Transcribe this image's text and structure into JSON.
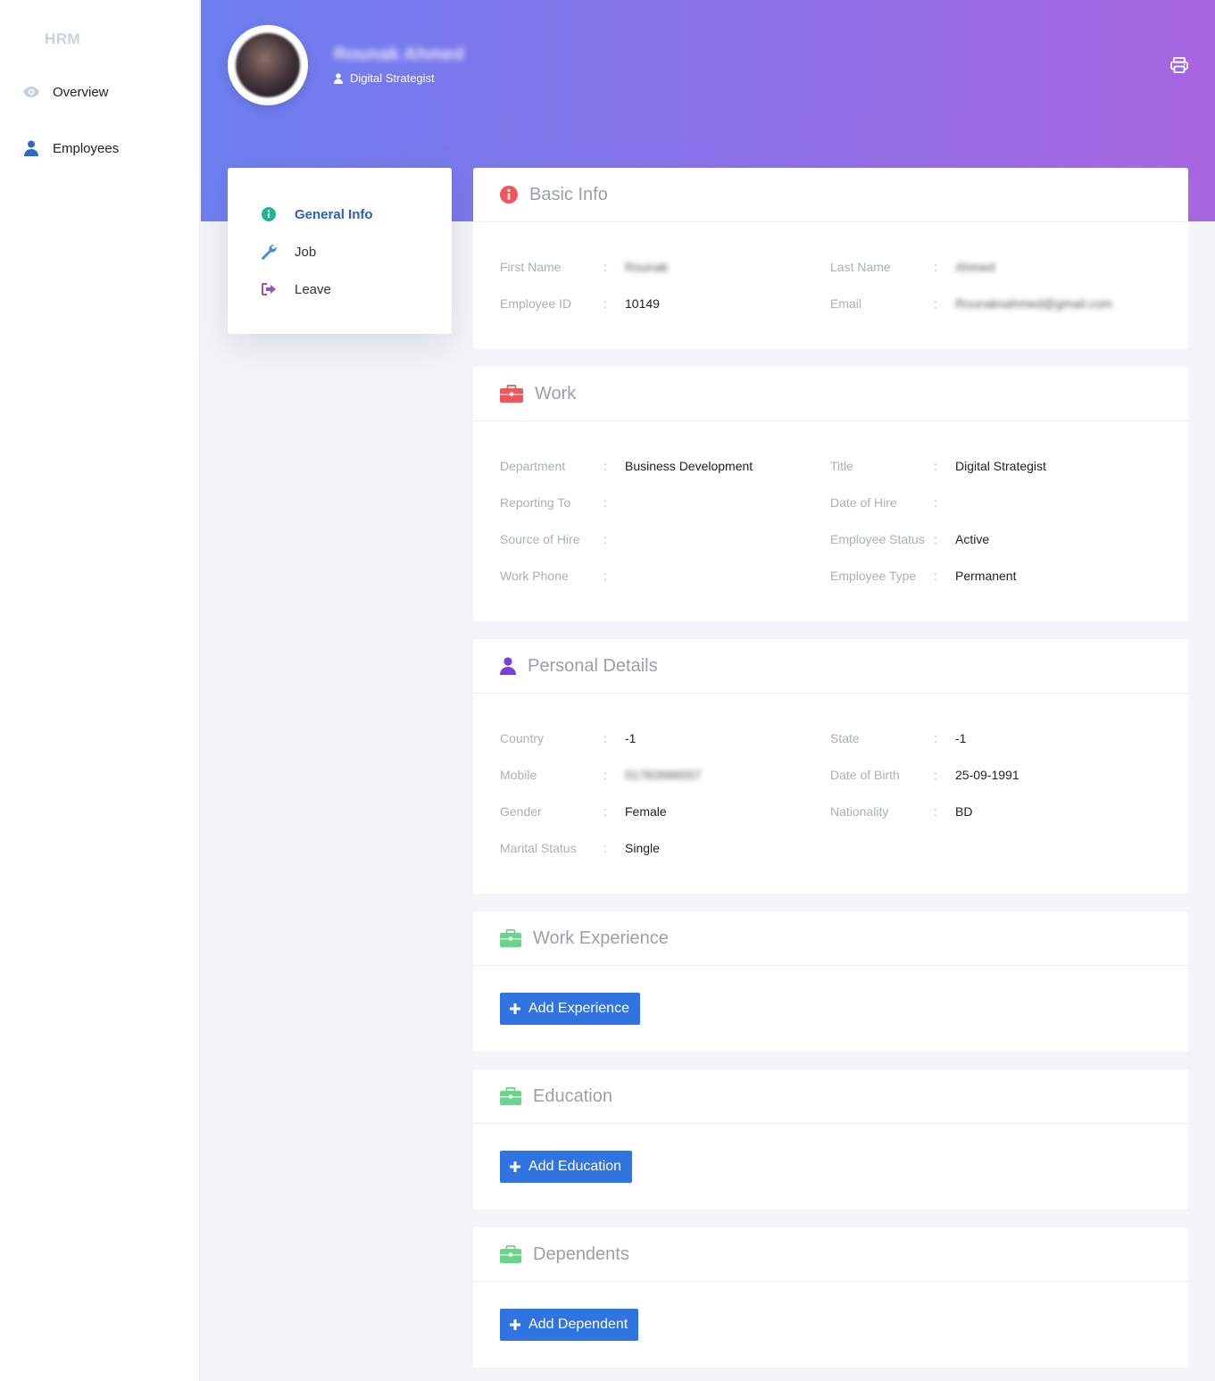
{
  "sidebar": {
    "brand": "HRM",
    "items": [
      {
        "label": "Overview",
        "icon": "eye-icon"
      },
      {
        "label": "Employees",
        "icon": "user-icon"
      }
    ]
  },
  "header": {
    "name": "Rounak Ahmed",
    "role": "Digital Strategist",
    "colors": {
      "start": "#6c7ff0",
      "end": "#a765e0"
    }
  },
  "tabs": [
    {
      "label": "General Info",
      "icon": "info-circle-icon",
      "active": true
    },
    {
      "label": "Job",
      "icon": "wrench-icon",
      "active": false
    },
    {
      "label": "Leave",
      "icon": "sign-out-icon",
      "active": false
    }
  ],
  "basic_info": {
    "title": "Basic Info",
    "fields": {
      "first_name": {
        "label": "First Name",
        "value": "Rounak"
      },
      "last_name": {
        "label": "Last Name",
        "value": "Ahmed"
      },
      "employee_id": {
        "label": "Employee ID",
        "value": "10149"
      },
      "email": {
        "label": "Email",
        "value": "Rounaksahmed@gmail.com"
      }
    }
  },
  "work": {
    "title": "Work",
    "fields": {
      "department": {
        "label": "Department",
        "value": "Business Development"
      },
      "title": {
        "label": "Title",
        "value": "Digital Strategist"
      },
      "reporting_to": {
        "label": "Reporting To",
        "value": ""
      },
      "date_of_hire": {
        "label": "Date of Hire",
        "value": ""
      },
      "source_of_hire": {
        "label": "Source of Hire",
        "value": ""
      },
      "employee_status": {
        "label": "Employee Status",
        "value": "Active"
      },
      "work_phone": {
        "label": "Work Phone",
        "value": ""
      },
      "employee_type": {
        "label": "Employee Type",
        "value": "Permanent"
      }
    }
  },
  "personal": {
    "title": "Personal Details",
    "fields": {
      "country": {
        "label": "Country",
        "value": "-1"
      },
      "state": {
        "label": "State",
        "value": "-1"
      },
      "mobile": {
        "label": "Mobile",
        "value": "01782666557"
      },
      "dob": {
        "label": "Date of Birth",
        "value": "25-09-1991"
      },
      "gender": {
        "label": "Gender",
        "value": "Female"
      },
      "nationality": {
        "label": "Nationality",
        "value": "BD"
      },
      "marital_status": {
        "label": "Marital Status",
        "value": "Single"
      }
    }
  },
  "work_experience": {
    "title": "Work Experience",
    "button": "Add Experience"
  },
  "education": {
    "title": "Education",
    "button": "Add Education"
  },
  "dependents": {
    "title": "Dependents",
    "button": "Add Dependent"
  },
  "colors": {
    "accent_blue": "#2f74e0",
    "red_icon": "#f0545c",
    "green_icon": "#6bd48c",
    "purple_icon": "#7a3fd8"
  }
}
